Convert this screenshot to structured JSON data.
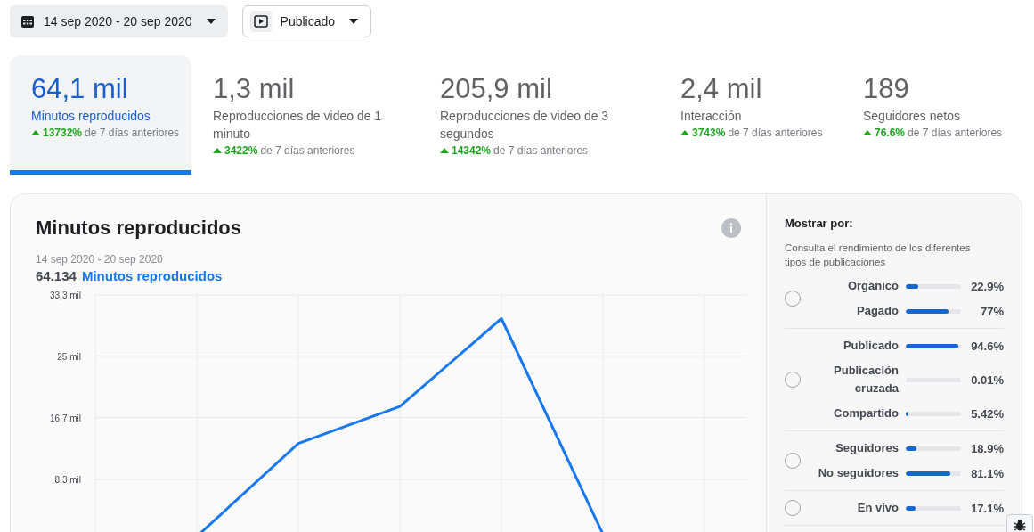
{
  "filters": [
    {
      "kind": "date",
      "label": "14 sep 2020 - 20 sep 2020"
    },
    {
      "kind": "post",
      "label": "Publicado"
    }
  ],
  "tabs": [
    {
      "value": "64,1 mil",
      "label": "Minutos reproducidos",
      "change": "13732%",
      "suffix": "de 7 días anteriores",
      "selected": true
    },
    {
      "value": "1,3 mil",
      "label": "Reproducciones de video de 1 minuto",
      "change": "3422%",
      "suffix": "de 7 días anteriores",
      "selected": false
    },
    {
      "value": "205,9 mil",
      "label": "Reproducciones de video de 3 segundos",
      "change": "14342%",
      "suffix": "de 7 días anteriores",
      "selected": false
    },
    {
      "value": "2,4 mil",
      "label": "Interacción",
      "change": "3743%",
      "suffix": "de 7 días anteriores",
      "selected": false
    },
    {
      "value": "189",
      "label": "Seguidores netos",
      "change": "76.6%",
      "suffix": "de 7 días anteriores",
      "selected": false
    }
  ],
  "chart_card": {
    "title": "Minutos reproducidos",
    "date_range": "14 sep 2020 - 20 sep 2020",
    "total": "64.134",
    "chart_data": {
      "type": "line",
      "grid": true,
      "categories": [
        null,
        null,
        null,
        null,
        null,
        null,
        null
      ],
      "ylim": [
        0,
        33.3
      ],
      "yticks": [
        {
          "value": 8.3,
          "label": "8,3 mil"
        },
        {
          "value": 16.7,
          "label": "16,7 mil"
        },
        {
          "value": 25,
          "label": "25 mil"
        },
        {
          "value": 33.3,
          "label": "33,3 mil"
        }
      ],
      "series": [
        {
          "name": "Minutos reproducidos",
          "color": "#1877f2",
          "values": [
            null,
            0.6,
            13.2,
            18.2,
            30.1,
            0.9,
            null
          ]
        }
      ]
    }
  },
  "breakdown": {
    "title": "Mostrar por:",
    "description": "Consulta el rendimiento de los diferentes tipos de publicaciones",
    "groups": [
      {
        "selected": false,
        "items": [
          {
            "label": "Orgánico",
            "level": 0.229,
            "value": "22.9%"
          },
          {
            "label": "Pagado",
            "level": 0.77,
            "value": "77%"
          }
        ]
      },
      {
        "selected": false,
        "items": [
          {
            "label": "Publicado",
            "level": 0.946,
            "value": "94.6%"
          },
          {
            "label": "Publicación cruzada",
            "value": "0.01%"
          },
          {
            "label": "Compartido",
            "level": 0.0542,
            "value": "5.42%"
          }
        ]
      },
      {
        "selected": false,
        "items": [
          {
            "label": "Seguidores",
            "level": 0.189,
            "value": "18.9%"
          },
          {
            "label": "No seguidores",
            "level": 0.811,
            "value": "81.1%"
          }
        ]
      },
      {
        "selected": false,
        "items": [
          {
            "label": "En vivo",
            "level": 0.171,
            "value": "17.1%"
          }
        ]
      }
    ]
  }
}
